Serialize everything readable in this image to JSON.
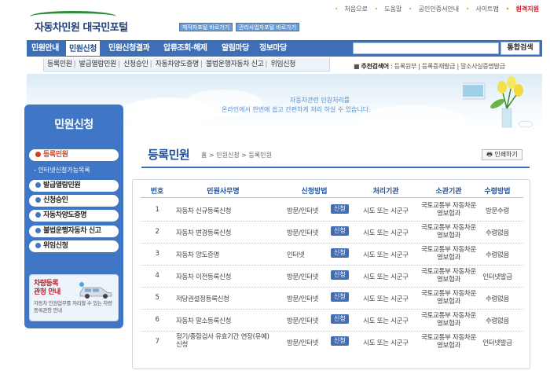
{
  "header": {
    "logo_text": "자동차민원 대국민포털",
    "btn1": "제작자포털 바로가기",
    "btn2": "관리사업자포털 바로가기",
    "util": [
      "처음으로",
      "도움말",
      "공인인증서안내",
      "사이트맵"
    ],
    "util_remote": "원격지원"
  },
  "nav": {
    "items": [
      "민원안내",
      "민원신청",
      "민원신청결과",
      "압류조회·해제",
      "알림마당",
      "정보마당"
    ],
    "active_index": 1,
    "search_placeholder": "",
    "search_button": "통합검색"
  },
  "subnav": {
    "items": [
      "등록민원",
      "발급열람민원",
      "신청승인",
      "자동차양도증명",
      "불법운행자동차 신고",
      "위임신청"
    ]
  },
  "recommend": {
    "label": "추천검색어",
    "items": [
      "등록원부",
      "등록증재발급",
      "말소사실증명발급"
    ]
  },
  "banner": {
    "line1": "자동차관련 민원처리를",
    "line2_pre": "온라인에서 한번에 쉽고 간편하게 처리 하실 수 있습니다."
  },
  "sidebar": {
    "title": "민원신청",
    "items": [
      "등록민원",
      "발급열람민원",
      "신청승인",
      "자동차양도증명",
      "불법운행자동차 신고",
      "위임신청"
    ],
    "active_index": 0,
    "sub_item": "인터넷신청가능목록",
    "box_title1": "차량등록",
    "box_title2": "관청 안내",
    "box_desc": "자동차 민원업무를 처리할 수 있는 차량등록관청 안내"
  },
  "content": {
    "title": "등록민원",
    "breadcrumb": "홈 > 민원신청 > 등록민원",
    "print": "인쇄하기"
  },
  "table": {
    "headers": [
      "번호",
      "민원사무명",
      "신청방법",
      "처리기관",
      "소관기관",
      "수령방법"
    ],
    "badge": "신청",
    "rows": [
      {
        "no": "1",
        "name": "자동차 신규등록신청",
        "method": "방문/인터넷",
        "proc": "시도 또는 시군구",
        "owner": "국토교통부 자동차운영보험과",
        "receive": "방문수령"
      },
      {
        "no": "2",
        "name": "자동차 변경등록신청",
        "method": "방문/인터넷",
        "proc": "시도 또는 시군구",
        "owner": "국토교통부 자동차운영보험과",
        "receive": "수령없음"
      },
      {
        "no": "3",
        "name": "자동차 양도증명",
        "method": "인터넷",
        "proc": "시도 또는 시군구",
        "owner": "국토교통부 자동차운영보험과",
        "receive": "수령없음"
      },
      {
        "no": "4",
        "name": "자동차 이전등록신청",
        "method": "방문/인터넷",
        "proc": "시도 또는 시군구",
        "owner": "국토교통부 자동차운영보험과",
        "receive": "인터넷발급"
      },
      {
        "no": "5",
        "name": "저당권설정등록신청",
        "method": "방문/인터넷",
        "proc": "시도 또는 시군구",
        "owner": "국토교통부 자동차운영보험과",
        "receive": "수령없음"
      },
      {
        "no": "6",
        "name": "자동차 말소등록신청",
        "method": "방문/인터넷",
        "proc": "시도 또는 시군구",
        "owner": "국토교통부 자동차운영보험과",
        "receive": "수령없음"
      },
      {
        "no": "7",
        "name": "정기/종합검사 유효기간 연장(유예)신청",
        "method": "방문/인터넷",
        "proc": "시도 또는 시군구",
        "owner": "국토교통부 자동차운영보험과",
        "receive": "인터넷발급"
      }
    ]
  },
  "colors": {
    "nav_blue": "#3c6fb8",
    "title_blue": "#1d4f98",
    "accent_red": "#c8191e",
    "active_orange": "#d63a1a"
  }
}
